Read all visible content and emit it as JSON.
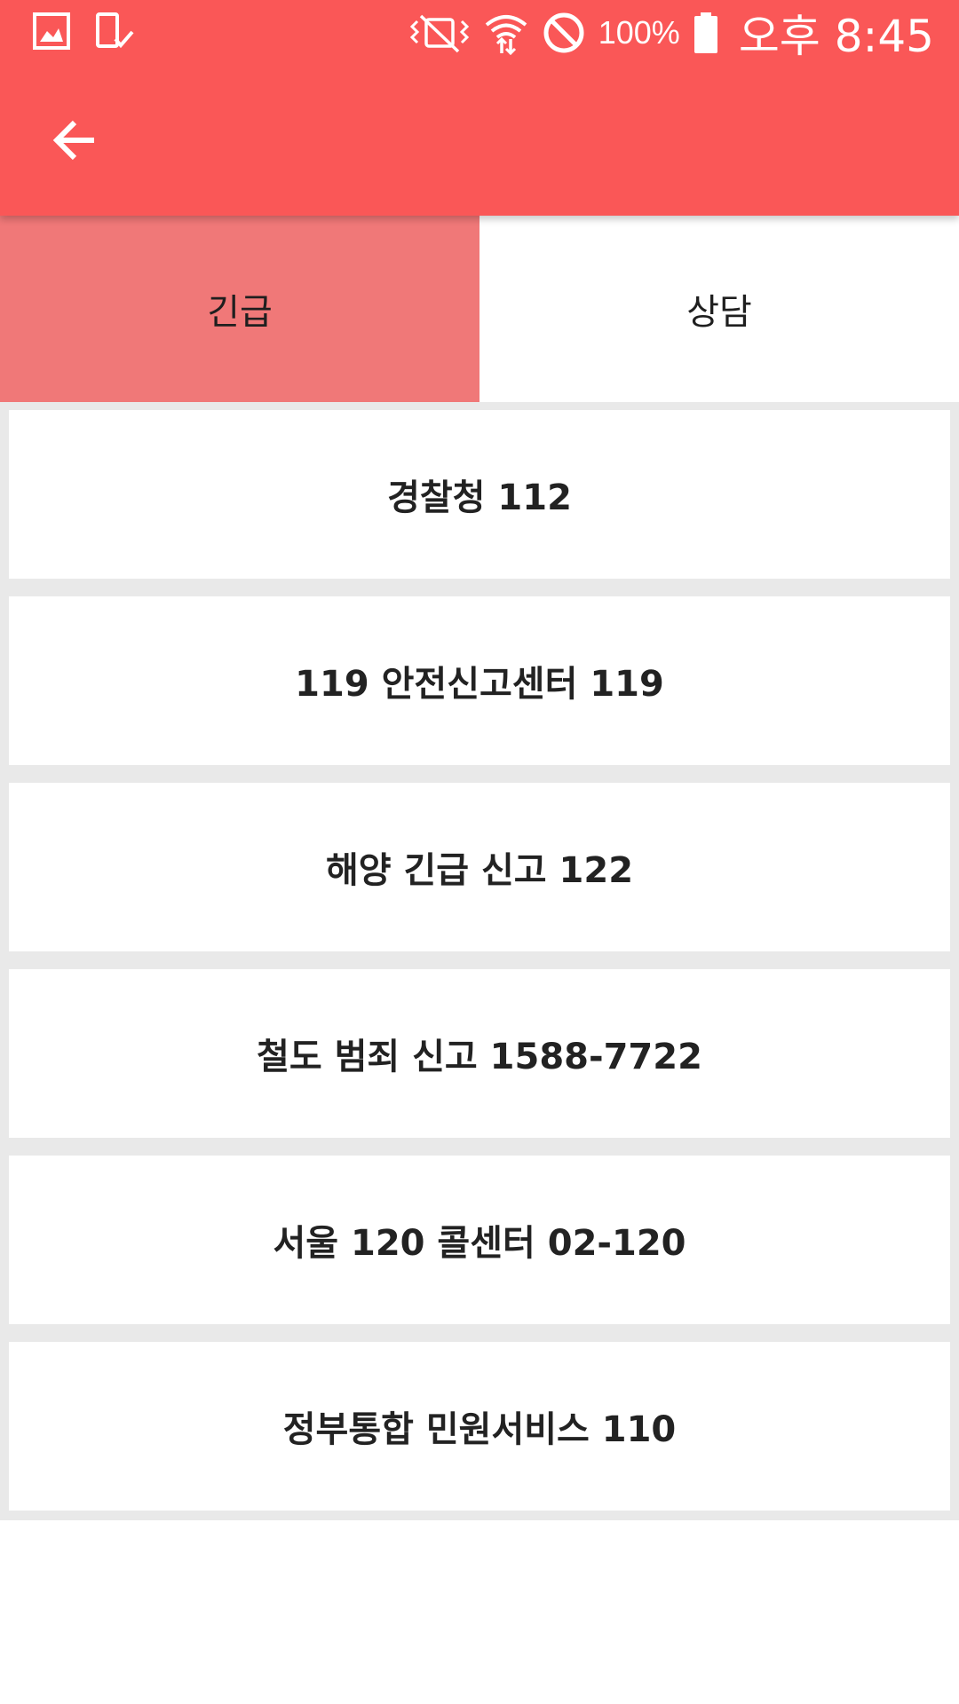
{
  "status_bar": {
    "battery_percent": "100%",
    "time": "오후 8:45",
    "icons": [
      "gallery-icon",
      "screenshot-icon",
      "vibrate-icon",
      "wifi-icon",
      "blocked-icon",
      "battery-icon"
    ]
  },
  "app_bar": {
    "back_icon": "arrow-left-icon"
  },
  "tabs": [
    {
      "label": "긴급",
      "active": true
    },
    {
      "label": "상담",
      "active": false
    }
  ],
  "list": {
    "items": [
      {
        "label": "경찰청 112"
      },
      {
        "label": "119 안전신고센터  119"
      },
      {
        "label": "해양 긴급 신고 122"
      },
      {
        "label": "철도 범죄 신고 1588-7722"
      },
      {
        "label": "서울 120 콜센터 02-120"
      },
      {
        "label": "정부통합 민원서비스 110"
      }
    ]
  },
  "colors": {
    "header": "#fa5757",
    "tab_active": "#f07878",
    "list_background": "#e9e9e9"
  }
}
